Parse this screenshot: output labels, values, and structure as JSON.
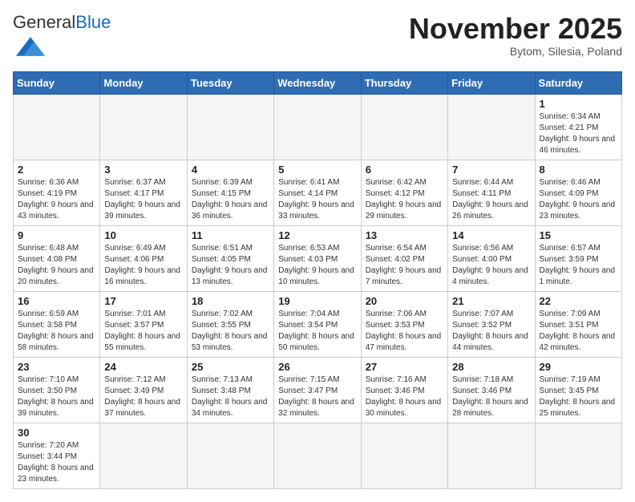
{
  "header": {
    "logo_general": "General",
    "logo_blue": "Blue",
    "month_title": "November 2025",
    "location": "Bytom, Silesia, Poland"
  },
  "days_of_week": [
    "Sunday",
    "Monday",
    "Tuesday",
    "Wednesday",
    "Thursday",
    "Friday",
    "Saturday"
  ],
  "weeks": [
    [
      {
        "day": "",
        "info": ""
      },
      {
        "day": "",
        "info": ""
      },
      {
        "day": "",
        "info": ""
      },
      {
        "day": "",
        "info": ""
      },
      {
        "day": "",
        "info": ""
      },
      {
        "day": "",
        "info": ""
      },
      {
        "day": "1",
        "info": "Sunrise: 6:34 AM\nSunset: 4:21 PM\nDaylight: 9 hours and 46 minutes."
      }
    ],
    [
      {
        "day": "2",
        "info": "Sunrise: 6:36 AM\nSunset: 4:19 PM\nDaylight: 9 hours and 43 minutes."
      },
      {
        "day": "3",
        "info": "Sunrise: 6:37 AM\nSunset: 4:17 PM\nDaylight: 9 hours and 39 minutes."
      },
      {
        "day": "4",
        "info": "Sunrise: 6:39 AM\nSunset: 4:15 PM\nDaylight: 9 hours and 36 minutes."
      },
      {
        "day": "5",
        "info": "Sunrise: 6:41 AM\nSunset: 4:14 PM\nDaylight: 9 hours and 33 minutes."
      },
      {
        "day": "6",
        "info": "Sunrise: 6:42 AM\nSunset: 4:12 PM\nDaylight: 9 hours and 29 minutes."
      },
      {
        "day": "7",
        "info": "Sunrise: 6:44 AM\nSunset: 4:11 PM\nDaylight: 9 hours and 26 minutes."
      },
      {
        "day": "8",
        "info": "Sunrise: 6:46 AM\nSunset: 4:09 PM\nDaylight: 9 hours and 23 minutes."
      }
    ],
    [
      {
        "day": "9",
        "info": "Sunrise: 6:48 AM\nSunset: 4:08 PM\nDaylight: 9 hours and 20 minutes."
      },
      {
        "day": "10",
        "info": "Sunrise: 6:49 AM\nSunset: 4:06 PM\nDaylight: 9 hours and 16 minutes."
      },
      {
        "day": "11",
        "info": "Sunrise: 6:51 AM\nSunset: 4:05 PM\nDaylight: 9 hours and 13 minutes."
      },
      {
        "day": "12",
        "info": "Sunrise: 6:53 AM\nSunset: 4:03 PM\nDaylight: 9 hours and 10 minutes."
      },
      {
        "day": "13",
        "info": "Sunrise: 6:54 AM\nSunset: 4:02 PM\nDaylight: 9 hours and 7 minutes."
      },
      {
        "day": "14",
        "info": "Sunrise: 6:56 AM\nSunset: 4:00 PM\nDaylight: 9 hours and 4 minutes."
      },
      {
        "day": "15",
        "info": "Sunrise: 6:57 AM\nSunset: 3:59 PM\nDaylight: 9 hours and 1 minute."
      }
    ],
    [
      {
        "day": "16",
        "info": "Sunrise: 6:59 AM\nSunset: 3:58 PM\nDaylight: 8 hours and 58 minutes."
      },
      {
        "day": "17",
        "info": "Sunrise: 7:01 AM\nSunset: 3:57 PM\nDaylight: 8 hours and 55 minutes."
      },
      {
        "day": "18",
        "info": "Sunrise: 7:02 AM\nSunset: 3:55 PM\nDaylight: 8 hours and 53 minutes."
      },
      {
        "day": "19",
        "info": "Sunrise: 7:04 AM\nSunset: 3:54 PM\nDaylight: 8 hours and 50 minutes."
      },
      {
        "day": "20",
        "info": "Sunrise: 7:06 AM\nSunset: 3:53 PM\nDaylight: 8 hours and 47 minutes."
      },
      {
        "day": "21",
        "info": "Sunrise: 7:07 AM\nSunset: 3:52 PM\nDaylight: 8 hours and 44 minutes."
      },
      {
        "day": "22",
        "info": "Sunrise: 7:09 AM\nSunset: 3:51 PM\nDaylight: 8 hours and 42 minutes."
      }
    ],
    [
      {
        "day": "23",
        "info": "Sunrise: 7:10 AM\nSunset: 3:50 PM\nDaylight: 8 hours and 39 minutes."
      },
      {
        "day": "24",
        "info": "Sunrise: 7:12 AM\nSunset: 3:49 PM\nDaylight: 8 hours and 37 minutes."
      },
      {
        "day": "25",
        "info": "Sunrise: 7:13 AM\nSunset: 3:48 PM\nDaylight: 8 hours and 34 minutes."
      },
      {
        "day": "26",
        "info": "Sunrise: 7:15 AM\nSunset: 3:47 PM\nDaylight: 8 hours and 32 minutes."
      },
      {
        "day": "27",
        "info": "Sunrise: 7:16 AM\nSunset: 3:46 PM\nDaylight: 8 hours and 30 minutes."
      },
      {
        "day": "28",
        "info": "Sunrise: 7:18 AM\nSunset: 3:46 PM\nDaylight: 8 hours and 28 minutes."
      },
      {
        "day": "29",
        "info": "Sunrise: 7:19 AM\nSunset: 3:45 PM\nDaylight: 8 hours and 25 minutes."
      }
    ],
    [
      {
        "day": "30",
        "info": "Sunrise: 7:20 AM\nSunset: 3:44 PM\nDaylight: 8 hours and 23 minutes."
      },
      {
        "day": "",
        "info": ""
      },
      {
        "day": "",
        "info": ""
      },
      {
        "day": "",
        "info": ""
      },
      {
        "day": "",
        "info": ""
      },
      {
        "day": "",
        "info": ""
      },
      {
        "day": "",
        "info": ""
      }
    ]
  ]
}
